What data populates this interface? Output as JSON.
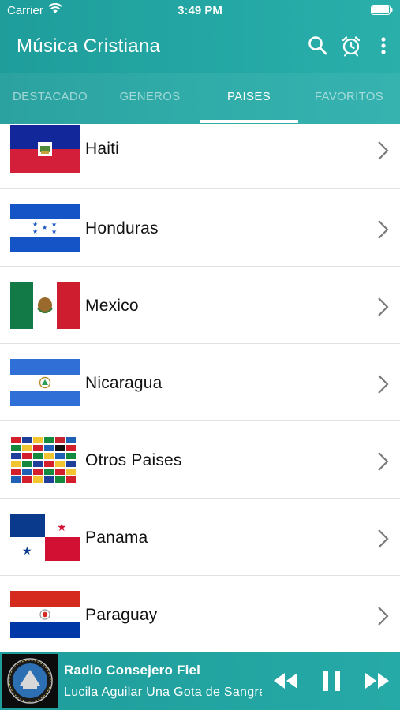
{
  "status_bar": {
    "carrier": "Carrier",
    "time": "3:49 PM"
  },
  "app": {
    "title": "Música Cristiana"
  },
  "toolbar": {
    "icons": [
      "search-icon",
      "alarm-icon",
      "more-vertical-icon"
    ]
  },
  "tabs": [
    {
      "label": "DESTACADO",
      "active": false
    },
    {
      "label": "GENEROS",
      "active": false
    },
    {
      "label": "PAISES",
      "active": true
    },
    {
      "label": "FAVORITOS",
      "active": false
    }
  ],
  "countries": [
    {
      "name": "Haiti",
      "flag": "haiti-flag-icon"
    },
    {
      "name": "Honduras",
      "flag": "honduras-flag-icon"
    },
    {
      "name": "Mexico",
      "flag": "mexico-flag-icon"
    },
    {
      "name": "Nicaragua",
      "flag": "nicaragua-flag-icon"
    },
    {
      "name": "Otros Paises",
      "flag": "world-flags-icon"
    },
    {
      "name": "Panama",
      "flag": "panama-flag-icon"
    },
    {
      "name": "Paraguay",
      "flag": "paraguay-flag-icon"
    }
  ],
  "player": {
    "station": "Radio Consejero Fiel",
    "track": "Lucila Aguilar Una Gota de Sangre",
    "controls": [
      "rewind-icon",
      "pause-icon",
      "fast-forward-icon"
    ]
  },
  "colors": {
    "accent": "#23a6a3",
    "text": "#111111",
    "divider": "#e2e2e2"
  }
}
